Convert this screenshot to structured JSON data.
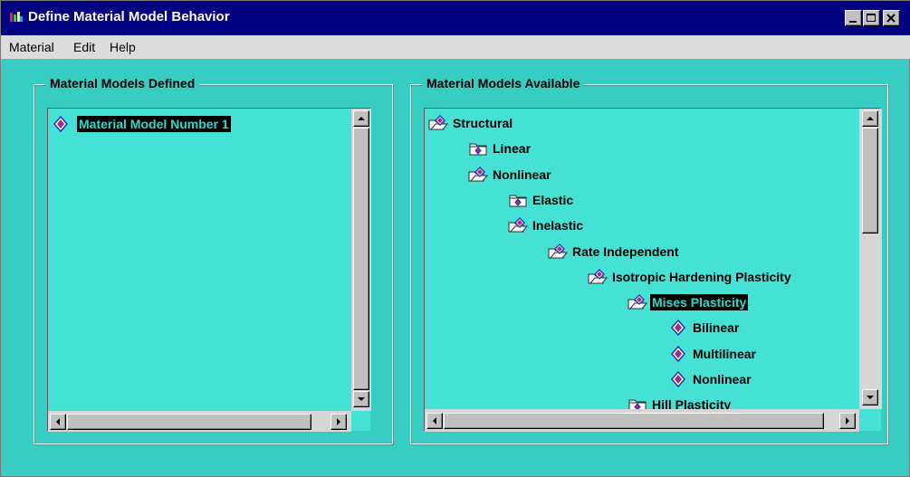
{
  "window": {
    "title": "Define Material Model Behavior",
    "controls": [
      "minimize",
      "maximize",
      "close"
    ]
  },
  "menubar": {
    "items": [
      "Material",
      "Edit",
      "Help"
    ]
  },
  "left_panel": {
    "label": "Material Models Defined",
    "items": [
      {
        "label": "Material Model Number 1",
        "icon": "material-model-icon",
        "selected": true
      }
    ]
  },
  "right_panel": {
    "label": "Material Models Available",
    "tree": [
      {
        "label": "Structural",
        "icon": "folder-icon",
        "level": 0
      },
      {
        "label": "Linear",
        "icon": "closed-folder-icon",
        "level": 1
      },
      {
        "label": "Nonlinear",
        "icon": "folder-icon",
        "level": 1
      },
      {
        "label": "Elastic",
        "icon": "closed-folder-icon",
        "level": 2
      },
      {
        "label": "Inelastic",
        "icon": "folder-icon",
        "level": 2
      },
      {
        "label": "Rate Independent",
        "icon": "folder-icon",
        "level": 3
      },
      {
        "label": "Isotropic Hardening Plasticity",
        "icon": "folder-icon",
        "level": 4
      },
      {
        "label": "Mises Plasticity",
        "icon": "folder-icon",
        "level": 5,
        "selected": true
      },
      {
        "label": "Bilinear",
        "icon": "material-model-icon",
        "level": 6
      },
      {
        "label": "Multilinear",
        "icon": "material-model-icon",
        "level": 6
      },
      {
        "label": "Nonlinear",
        "icon": "material-model-icon",
        "level": 6
      },
      {
        "label": "Hill Plasticity",
        "icon": "closed-folder-icon",
        "level": 5
      }
    ]
  },
  "colors": {
    "titlebar": "#000080",
    "background": "#37cdc3",
    "list_background": "#44e1d4",
    "selection": "#000000",
    "selection_text": "#2fd8cc"
  }
}
